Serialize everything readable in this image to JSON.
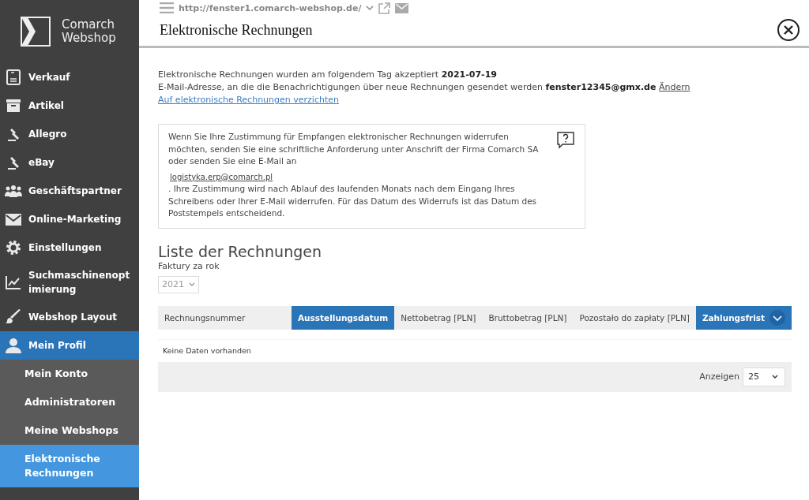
{
  "logo": {
    "line1": "Comarch",
    "line2": "Webshop"
  },
  "topbar": {
    "url": "http://fenster1.comarch-webshop.de/"
  },
  "sidebar": {
    "items": [
      {
        "label": "Verkauf",
        "selected": false
      },
      {
        "label": "Artikel",
        "selected": false
      },
      {
        "label": "Allegro",
        "selected": false
      },
      {
        "label": "eBay",
        "selected": false
      },
      {
        "label": "Geschäftspartner",
        "selected": false
      },
      {
        "label": "Online-Marketing",
        "selected": false
      },
      {
        "label": "Einstellungen",
        "selected": false
      },
      {
        "label": "Suchmaschinenoptimierung",
        "selected": false
      },
      {
        "label": "Webshop Layout",
        "selected": false
      },
      {
        "label": "Mein Profil",
        "selected": true,
        "children": [
          {
            "label": "Mein Konto",
            "selected": false
          },
          {
            "label": "Administratoren",
            "selected": false
          },
          {
            "label": "Meine Webshops",
            "selected": false
          },
          {
            "label": "Elektronische Rechnungen",
            "selected": true
          }
        ]
      }
    ]
  },
  "page": {
    "title": "Elektronische Rechnungen"
  },
  "info": {
    "accepted": "Elektronische Rechnungen wurden am folgendem Tag akzeptiert **2021-07-19**",
    "email_line": "E-Mail-Adresse, an die die Benachrichtigungen über neue Rechnungen gesendet werden **fenster12345@gmx.de**",
    "change_link": "Ändern",
    "opt_out_link": "Auf elektronische Rechnungen verzichten"
  },
  "notice": {
    "text_1": "Wenn Sie Ihre Zustimmung für Empfangen elektronischer Rechnungen widerrufen möchten, senden Sie eine schriftliche Anforderung unter Anschrift der Firma Comarch SA oder senden Sie eine E-Mail an",
    "email_link": "logistyka.erp@comarch.pl",
    "text_2": ". Ihre Zustimmung wird nach Ablauf des laufenden Monats nach dem Eingang Ihres Schreibens oder Ihrer E-Mail widerrufen. Für das Datum des Widerrufs ist das Datum des Poststempels entscheidend."
  },
  "invoices": {
    "heading": "Liste der Rechnungen",
    "year_label": "Faktury za rok",
    "year": "2021",
    "columns": [
      {
        "label": "Rechnungsnummer",
        "selected": false
      },
      {
        "label": "Ausstellungsdatum",
        "selected": true
      },
      {
        "label": "Nettobetrag [PLN]",
        "selected": false
      },
      {
        "label": "Bruttobetrag [PLN]",
        "selected": false
      },
      {
        "label": "Pozostało do zapłaty [PLN]",
        "selected": false
      },
      {
        "label": "Zahlungsfrist",
        "selected": true
      }
    ],
    "empty": "Keine Daten vorhanden",
    "page_size_label": "Anzeigen",
    "page_size": "25"
  }
}
